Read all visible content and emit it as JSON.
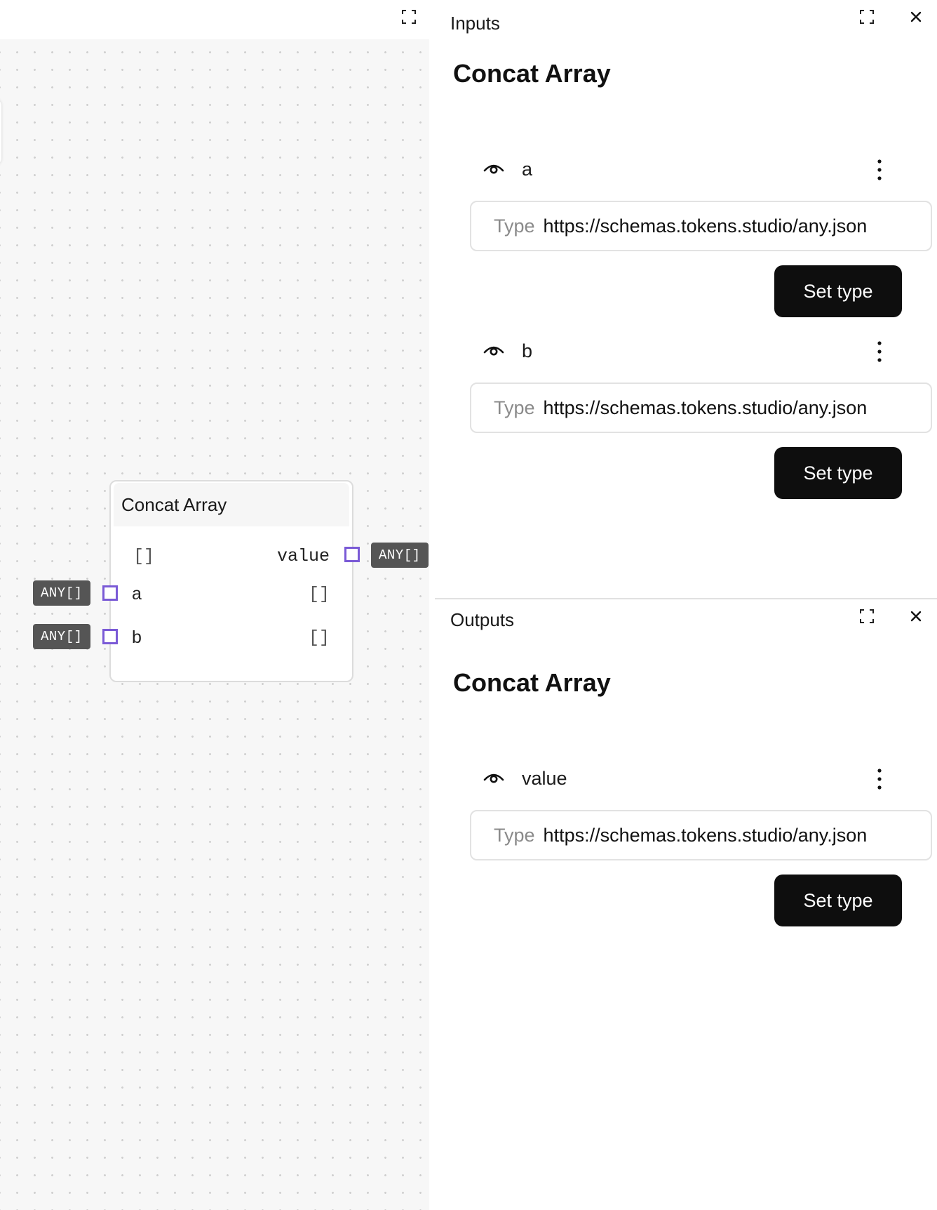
{
  "canvas": {
    "node": {
      "title": "Concat Array",
      "output": {
        "default": "[]",
        "name": "value",
        "type": "ANY[]"
      },
      "inputs": [
        {
          "name": "a",
          "default": "[]",
          "type": "ANY[]"
        },
        {
          "name": "b",
          "default": "[]",
          "type": "ANY[]"
        }
      ]
    },
    "icons": {
      "expand": "expand-icon"
    },
    "colors": {
      "port": "#7a5ad6",
      "badge": "#555555"
    }
  },
  "inputs_panel": {
    "title": "Inputs",
    "heading": "Concat Array",
    "fields": [
      {
        "name": "a",
        "type_label": "Type",
        "type_value": "https://schemas.tokens.studio/any.json",
        "button": "Set type"
      },
      {
        "name": "b",
        "type_label": "Type",
        "type_value": "https://schemas.tokens.studio/any.json",
        "button": "Set type"
      }
    ]
  },
  "outputs_panel": {
    "title": "Outputs",
    "heading": "Concat Array",
    "fields": [
      {
        "name": "value",
        "type_label": "Type",
        "type_value": "https://schemas.tokens.studio/any.json",
        "button": "Set type"
      }
    ]
  }
}
